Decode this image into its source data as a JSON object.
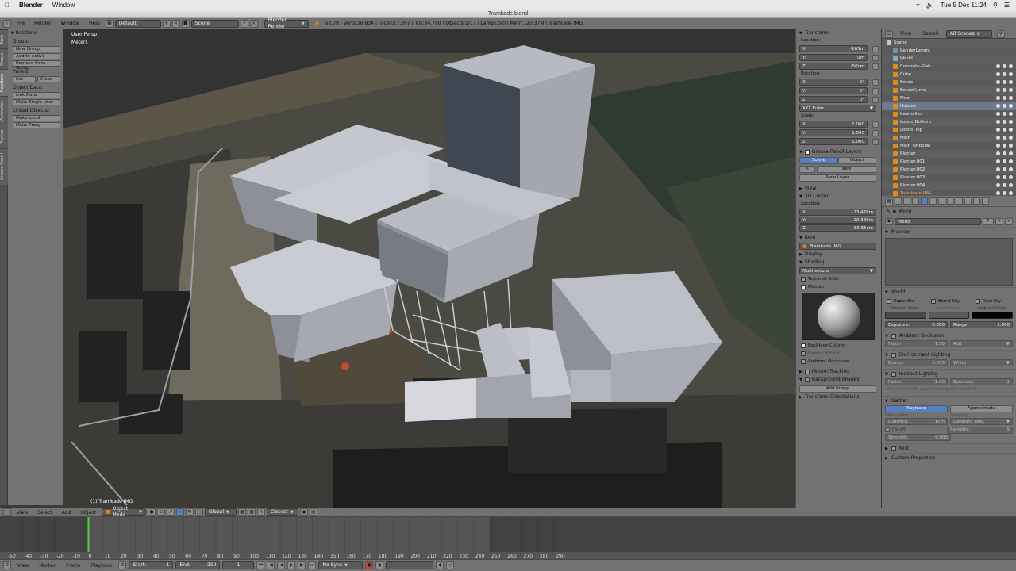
{
  "mac": {
    "app": "Blender",
    "menus": [
      "Window"
    ],
    "clock": "Tue 5 Dec  11:24"
  },
  "window": {
    "title": "Tramkade.blend"
  },
  "info_header": {
    "menus": [
      "File",
      "Render",
      "Window",
      "Help"
    ],
    "layout": "Default",
    "scene": "Scene",
    "engine": "Blender Render",
    "stats": "v2.79 | Verts:26,834 | Faces:17,397 | Tris:34,790 | Objects:1/17 | Lamps:0/0 | Mem:120.37M | Tramkade IMG"
  },
  "left_tabs": [
    "Tools",
    "Create",
    "Relations",
    "Animation",
    "Physics",
    "Grease Pencil"
  ],
  "relations": {
    "title": "Relations",
    "group_label": "Group:",
    "new_group": "New Group",
    "add_to_active": "Add to Active",
    "remove_from_group": "Remove from Group",
    "parent_label": "Parent:",
    "set": "Set",
    "clear": "Clear",
    "object_data_label": "Object Data:",
    "link_data": "Link Data",
    "make_single_user": "Make Single User",
    "linked_objects_label": "Linked Objects:",
    "make_local": "Make Local",
    "make_proxy": "Make Proxy"
  },
  "viewport": {
    "view_name": "User Persp",
    "units": "Meters",
    "object_label": "(1) Tramkade IMG"
  },
  "transform": {
    "title": "Transform",
    "location_label": "Location:",
    "loc": [
      {
        "axis": "X:",
        "value": "-165m"
      },
      {
        "axis": "Y:",
        "value": "0m"
      },
      {
        "axis": "Z:",
        "value": "-50cm"
      }
    ],
    "rotation_label": "Rotation:",
    "rot": [
      {
        "axis": "X:",
        "value": "0°"
      },
      {
        "axis": "Y:",
        "value": "0°"
      },
      {
        "axis": "Z:",
        "value": "0°"
      }
    ],
    "euler": "XYZ Euler",
    "scale_label": "Scale:",
    "scale": [
      {
        "axis": "X:",
        "value": "1.000"
      },
      {
        "axis": "Y:",
        "value": "1.000"
      },
      {
        "axis": "Z:",
        "value": "1.000"
      }
    ]
  },
  "grease_pencil": {
    "title": "Grease Pencil Layers",
    "tab_scene": "Scene",
    "tab_object": "Object",
    "new": "New",
    "new_layer": "New Layer"
  },
  "npanel_more": {
    "view": "View",
    "cursor_title": "3D Cursor",
    "location_label": "Location:",
    "cursor": [
      {
        "axis": "X:",
        "value": "-23.478m"
      },
      {
        "axis": "Y:",
        "value": "20.386m"
      },
      {
        "axis": "Z:",
        "value": "-85.65cm"
      }
    ],
    "item": "Item",
    "item_name": "Tramkade IMG",
    "display": "Display",
    "shading": "Shading",
    "shade_mode": "Multitexture",
    "textured_solid": "Textured Solid",
    "matcap": "Matcap",
    "backface_culling": "Backface Culling",
    "depth_of_field": "Depth Of Field",
    "ambient_occlusion": "Ambient Occlusion",
    "motion_tracking": "Motion Tracking",
    "background_images": "Background Images",
    "add_image": "Add Image",
    "transform_orientations": "Transform Orientations"
  },
  "outliner": {
    "view": "View",
    "search": "Search",
    "filter": "All Scenes",
    "items": [
      "Scene",
      "RenderLayers",
      "World",
      "Concrete-Slab",
      "Cube",
      "Fence",
      "FenceCurve",
      "Floor",
      "Huisjes",
      "Kaaihallen",
      "Loods_Bottom",
      "Loods_Top",
      "Main",
      "Main_Uitbouw",
      "Planter",
      "Planter.001",
      "Planter.002",
      "Planter.003",
      "Planter.004",
      "Tramkade IMG"
    ]
  },
  "world_props": {
    "crumb": "World",
    "world_name": "World",
    "f_flag": "F",
    "preview": "Preview",
    "world": "World",
    "paper_sky": "Paper Sky",
    "blend_sky": "Blend Sky",
    "real_sky": "Real Sky",
    "horizon_color": "Horizon Color:",
    "zenith_color": "Zenith Color:",
    "ambient_color": "Ambient Color:",
    "exposure": "Exposure:",
    "exposure_val": "0.000",
    "range": "Range:",
    "range_val": "1.000",
    "ambient_occlusion": "Ambient Occlusion",
    "factor": "Factor:",
    "factor_val": "1.00",
    "add": "Add",
    "env_lighting": "Environment Lighting",
    "energy": "Energy:",
    "energy_val": "1.000",
    "white": "White",
    "indirect": "Indirect Lighting",
    "indirect_factor_val": "1.00",
    "bounces": "Bounces:",
    "bounces_val": "1",
    "indirect_note": "Only works with approximate gather method",
    "gather": "Gather",
    "raytrace": "Raytrace",
    "approximate": "Approximate",
    "attenuation": "Attenuation:",
    "sampling": "Sampling:",
    "distance": "Distance:",
    "distance_val": "10m",
    "constant_qmc": "Constant QMC",
    "falloff": "Falloff",
    "samples": "Samples:",
    "samples_val": "5",
    "strength": "Strength:",
    "strength_val": "0.000",
    "mist": "Mist",
    "custom_props": "Custom Properties"
  },
  "view3d_header": {
    "menus": [
      "View",
      "Select",
      "Add",
      "Object"
    ],
    "mode": "Object Mode",
    "orientation": "Global",
    "snap": "Closest"
  },
  "timeline": {
    "ticks": [
      "-50",
      "-40",
      "-30",
      "-20",
      "-10",
      "0",
      "10",
      "20",
      "30",
      "40",
      "50",
      "60",
      "70",
      "80",
      "90",
      "100",
      "110",
      "120",
      "130",
      "140",
      "150",
      "160",
      "170",
      "180",
      "190",
      "200",
      "210",
      "220",
      "230",
      "240",
      "250",
      "260",
      "270",
      "280",
      "290"
    ],
    "menus": [
      "View",
      "Marker",
      "Frame",
      "Playback"
    ],
    "start_label": "Start:",
    "start": "1",
    "end_label": "End:",
    "end": "250",
    "current": "1",
    "sync": "No Sync"
  }
}
